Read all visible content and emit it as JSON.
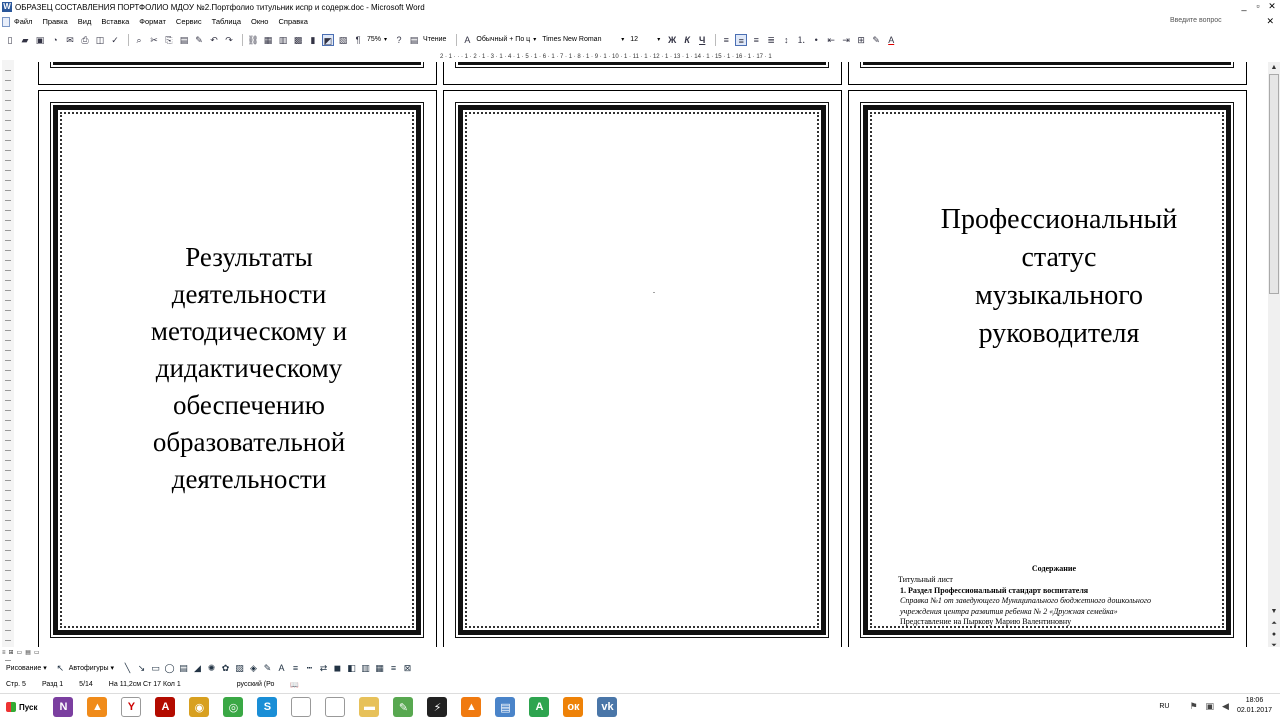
{
  "window": {
    "title": "ОБРАЗЕЦ СОСТАВЛЕНИЯ ПОРТФОЛИО МДОУ №2.Портфолио титульник испр и содерж.doc - Microsoft Word",
    "min_icon": "_",
    "max_icon": "▫",
    "close_icon": "✕",
    "doc_close_icon": "✕"
  },
  "menu": {
    "items": [
      "Файл",
      "Правка",
      "Вид",
      "Вставка",
      "Формат",
      "Сервис",
      "Таблица",
      "Окно",
      "Справка"
    ],
    "help_placeholder": "Введите вопрос"
  },
  "toolbar": {
    "zoom": "75%",
    "reading": "Чтение",
    "style": "Обычный + По ц",
    "font": "Times New Roman",
    "size": "12",
    "bold": "Ж",
    "italic": "К",
    "underline": "Ч",
    "paragraph_mark": "¶"
  },
  "ruler": {
    "text": "2 · 1 · · · 1 · 2 · 1 · 3 · 1 · 4 · 1 · 5 · 1 · 6 · 1 · 7 · 1 · 8 · 1 · 9 · 1 · 10 · 1 · 11 · 1 · 12 · 1 · 13 · 1 · 14 · 1 · 15 · 1 · 16 · 1 · 17 · 1"
  },
  "pages": {
    "left_text": [
      "Результаты",
      "деятельности",
      "методическому и",
      "дидактическому",
      "обеспечению",
      "образовательной",
      "деятельности"
    ],
    "middle_text": ".",
    "right_title": [
      "Профессиональный",
      "статус",
      "музыкального",
      "руководителя"
    ],
    "contents_heading": "Содержание",
    "contents_lines": [
      "Титульный лист",
      "1.  Раздел Профессиональный стандарт воспитателя",
      "Справка №1 от заведующего Муниципального бюджетного дошкольного",
      "учреждения центра развития ребенка № 2 «Дружная семейка»",
      "Представление на Пыркову Марию Валентиновну"
    ]
  },
  "viewbar": {
    "items": [
      "≡",
      "⊞",
      "▭",
      "▤",
      "▭"
    ]
  },
  "drawing": {
    "draw_label": "Рисование ▾",
    "autoshapes_label": "Автофигуры ▾"
  },
  "status": {
    "page": "Стр.  5",
    "section": "Разд  1",
    "pages": "5/14",
    "position": "На  11,2см  Ст  17   Кол  1",
    "language": "русский (Ро"
  },
  "taskbar": {
    "start": "Пуск",
    "lang": "RU",
    "time": "18:06",
    "date": "02.01.2017",
    "apps": [
      {
        "name": "onenote",
        "glyph": "N",
        "color": "#7b3fa0"
      },
      {
        "name": "avast",
        "glyph": "▲",
        "color": "#f08b1a"
      },
      {
        "name": "yandex",
        "glyph": "Y",
        "color": "#ffffff"
      },
      {
        "name": "acrobat",
        "glyph": "A",
        "color": "#b30b00"
      },
      {
        "name": "media",
        "glyph": "◉",
        "color": "#d8a020"
      },
      {
        "name": "chrome",
        "glyph": "◎",
        "color": "#3aa845"
      },
      {
        "name": "skype",
        "glyph": "S",
        "color": "#1a8ed6"
      },
      {
        "name": "document",
        "glyph": "",
        "color": "#ffffff"
      },
      {
        "name": "document2",
        "glyph": "",
        "color": "#ffffff"
      },
      {
        "name": "folder",
        "glyph": "▬",
        "color": "#e7c15a"
      },
      {
        "name": "notepad",
        "glyph": "✎",
        "color": "#58a850"
      },
      {
        "name": "winamp",
        "glyph": "⚡",
        "color": "#222222"
      },
      {
        "name": "vlc",
        "glyph": "▲",
        "color": "#f07a10"
      },
      {
        "name": "notes",
        "glyph": "▤",
        "color": "#4a84c9"
      },
      {
        "name": "adobe-a",
        "glyph": "A",
        "color": "#2ea44f"
      },
      {
        "name": "odnoklassniki",
        "glyph": "ок",
        "color": "#ee8208"
      },
      {
        "name": "vk",
        "glyph": "vk",
        "color": "#4a76a8"
      }
    ]
  }
}
